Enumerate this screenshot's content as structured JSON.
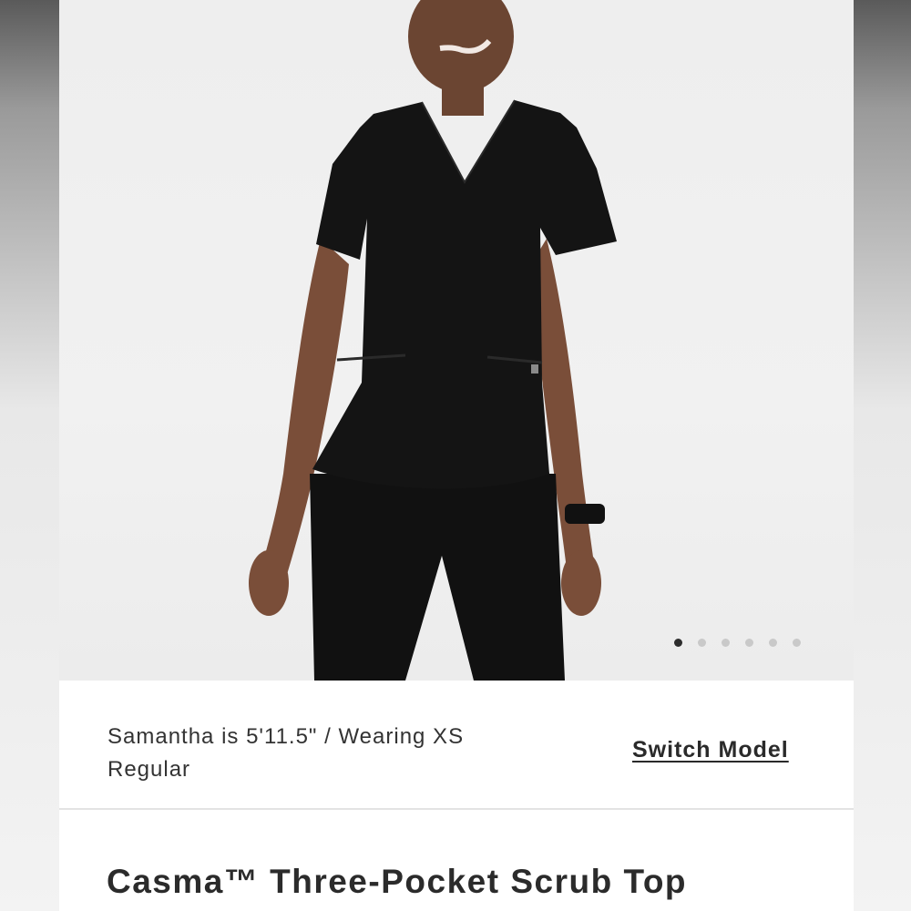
{
  "gallery": {
    "image_alt": "Model wearing black Casma Three-Pocket Scrub Top",
    "dots": [
      {
        "active": true
      },
      {
        "active": false
      },
      {
        "active": false
      },
      {
        "active": false
      },
      {
        "active": false
      },
      {
        "active": false
      }
    ]
  },
  "model_info": {
    "text": "Samantha is 5'11.5\" / Wearing XS Regular",
    "switch_label": "Switch Model"
  },
  "product": {
    "title": "Casma™ Three-Pocket Scrub Top"
  },
  "colors": {
    "garment": "#141414",
    "background": "#eeeeee",
    "text": "#2b2b2b"
  }
}
